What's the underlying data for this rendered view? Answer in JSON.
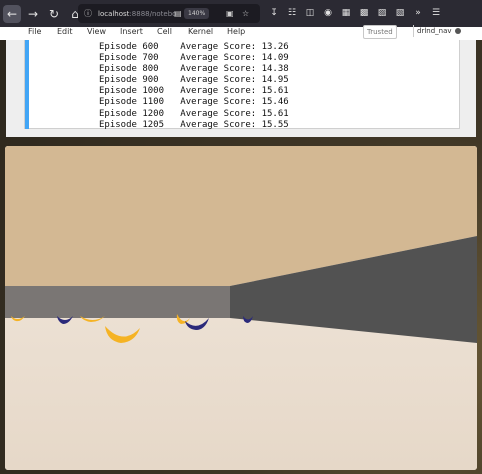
{
  "browser": {
    "url_host": "localhost",
    "url_rest": ":8888/notebo",
    "zoom": "140%",
    "icons": [
      "back-arrow-icon",
      "forward-arrow-icon",
      "reload-icon",
      "home-icon",
      "reader-view-icon",
      "pocket-icon",
      "star-icon",
      "download-icon",
      "library-icon",
      "sidebar-icon",
      "extension-icon",
      "extension-icon-2",
      "extension-icon-3",
      "extension-icon-4",
      "overflow-icon",
      "menu-icon"
    ]
  },
  "menubar": {
    "items": [
      "File",
      "Edit",
      "View",
      "Insert",
      "Cell",
      "Kernel",
      "Help"
    ],
    "trusted": "Trusted",
    "kernel": "drlnd_nav"
  },
  "output": {
    "lines": [
      {
        "episode": "Episode 600",
        "score": "Average Score: 13.26"
      },
      {
        "episode": "Episode 700",
        "score": "Average Score: 14.09"
      },
      {
        "episode": "Episode 800",
        "score": "Average Score: 14.38"
      },
      {
        "episode": "Episode 900",
        "score": "Average Score: 14.95"
      },
      {
        "episode": "Episode 1000",
        "score": "Average Score: 15.61"
      },
      {
        "episode": "Episode 1100",
        "score": "Average Score: 15.46"
      },
      {
        "episode": "Episode 1200",
        "score": "Average Score: 15.61"
      },
      {
        "episode": "Episode 1205",
        "score": "Average Score: 15.55"
      }
    ]
  },
  "game": {
    "colors": {
      "sky": "#d3b893",
      "wall": "#7a7674",
      "wall_side": "#525252",
      "floor": "#efe4d8",
      "yellow_banana": "#f5b324",
      "blue_banana": "#2b2a7a"
    }
  }
}
